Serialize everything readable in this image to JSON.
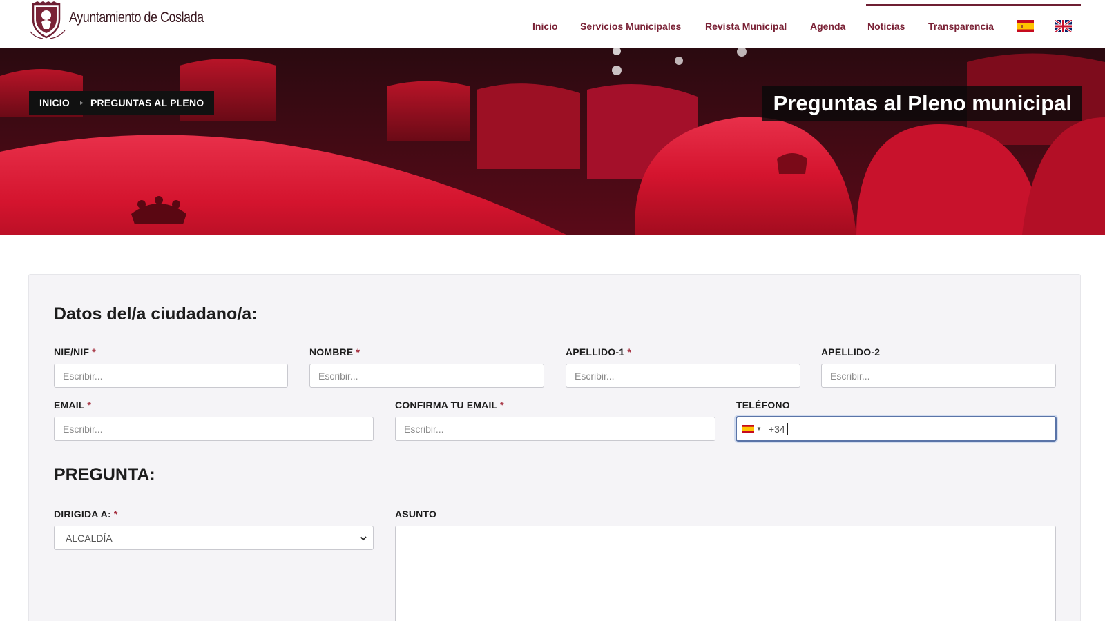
{
  "header": {
    "logo_text": "Ayuntamiento de Coslada",
    "logo_crest_icon": "coslada-crest-logo",
    "nav": [
      {
        "label": "Inicio"
      },
      {
        "label": "Servicios Municipales"
      },
      {
        "label": "Revista Municipal"
      },
      {
        "label": "Agenda"
      },
      {
        "label": "Noticias"
      },
      {
        "label": "Transparencia"
      }
    ],
    "languages": [
      {
        "icon": "spain-flag-icon",
        "lang": "es"
      },
      {
        "icon": "uk-flag-icon",
        "lang": "en"
      }
    ]
  },
  "hero": {
    "breadcrumb": [
      "INICIO",
      "PREGUNTAS AL PLENO"
    ],
    "title": "Preguntas al Pleno municipal"
  },
  "form": {
    "section_citizen": "Datos del/a ciudadano/a:",
    "section_question": "PREGUNTA:",
    "required_mark": "*",
    "fields": {
      "nie": {
        "label": "NIE/NIF",
        "placeholder": "Escribir...",
        "required": true
      },
      "nombre": {
        "label": "NOMBRE",
        "placeholder": "Escribir...",
        "required": true
      },
      "apellido1": {
        "label": "APELLIDO-1",
        "placeholder": "Escribir...",
        "required": true
      },
      "apellido2": {
        "label": "APELLIDO-2",
        "placeholder": "Escribir...",
        "required": false
      },
      "email": {
        "label": "EMAIL",
        "placeholder": "Escribir...",
        "required": true
      },
      "confirm_email": {
        "label": "CONFIRMA TU EMAIL",
        "placeholder": "Escribir...",
        "required": true
      },
      "telefono": {
        "label": "TELÉFONO",
        "dial_code": "+34",
        "flag_icon": "spain-flag-icon",
        "required": false
      },
      "dirigida": {
        "label": "DIRIGIDA A:",
        "selected": "ALCALDÍA",
        "required": true
      },
      "asunto": {
        "label": "ASUNTO",
        "value": "",
        "required": false
      }
    }
  },
  "colors": {
    "brand": "#7a2236",
    "focus_border": "#5a74a8",
    "required": "#a32a3a"
  }
}
